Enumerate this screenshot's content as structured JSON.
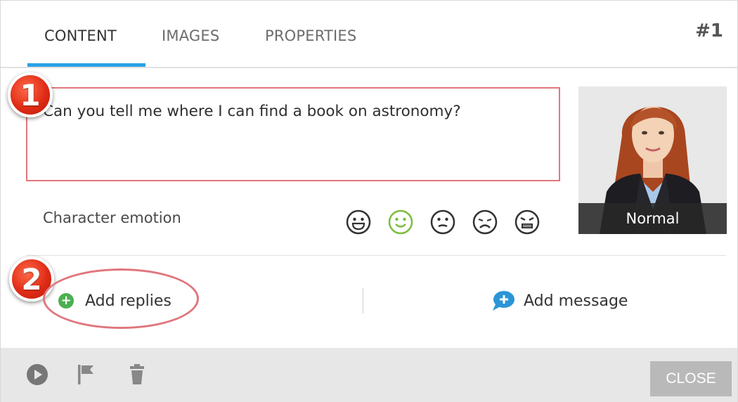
{
  "tabs": [
    {
      "label": "CONTENT",
      "active": true
    },
    {
      "label": "IMAGES",
      "active": false
    },
    {
      "label": "PROPERTIES",
      "active": false
    }
  ],
  "scene_number": "#1",
  "message": {
    "text": "Can you tell me where I can find a book on astronomy?"
  },
  "steps": {
    "one": "1",
    "two": "2"
  },
  "character": {
    "emotion_label": "Character emotion",
    "portrait_label": "Normal",
    "emotions": [
      {
        "name": "happy-emotion-icon",
        "selected": false
      },
      {
        "name": "normal-emotion-icon",
        "selected": true
      },
      {
        "name": "neutral-emotion-icon",
        "selected": false
      },
      {
        "name": "sad-emotion-icon",
        "selected": false
      },
      {
        "name": "angry-emotion-icon",
        "selected": false
      }
    ]
  },
  "actions": {
    "add_replies": "Add replies",
    "add_message": "Add message"
  },
  "footer": {
    "icons": [
      "play-icon",
      "flag-icon",
      "trash-icon"
    ],
    "close_label": "CLOSE"
  },
  "colors": {
    "accent": "#2aa1e6",
    "highlight": "#e0767c",
    "selected_emotion": "#7cbd3c",
    "plus_green": "#4caf50",
    "bubble_blue": "#2b95d6"
  }
}
